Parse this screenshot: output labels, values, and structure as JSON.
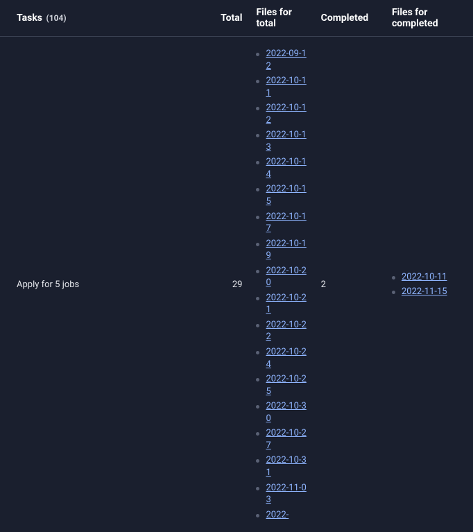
{
  "table": {
    "header": {
      "tasks": "Tasks",
      "count_label": "(104)",
      "total": "Total",
      "files_total": "Files for total",
      "completed": "Completed",
      "files_completed": "Files for completed"
    },
    "rows": [
      {
        "task": "Apply for 5 jobs",
        "total": "29",
        "completed": "2",
        "files_total": [
          "2022-09-12",
          "2022-10-11",
          "2022-10-12",
          "2022-10-13",
          "2022-10-14",
          "2022-10-15",
          "2022-10-17",
          "2022-10-19",
          "2022-10-20",
          "2022-10-21",
          "2022-10-22",
          "2022-10-24",
          "2022-10-25",
          "2022-10-30",
          "2022-10-27",
          "2022-10-31",
          "2022-11-03",
          "2022-"
        ],
        "files_completed": [
          "2022-10-11",
          "2022-11-15"
        ]
      }
    ]
  }
}
